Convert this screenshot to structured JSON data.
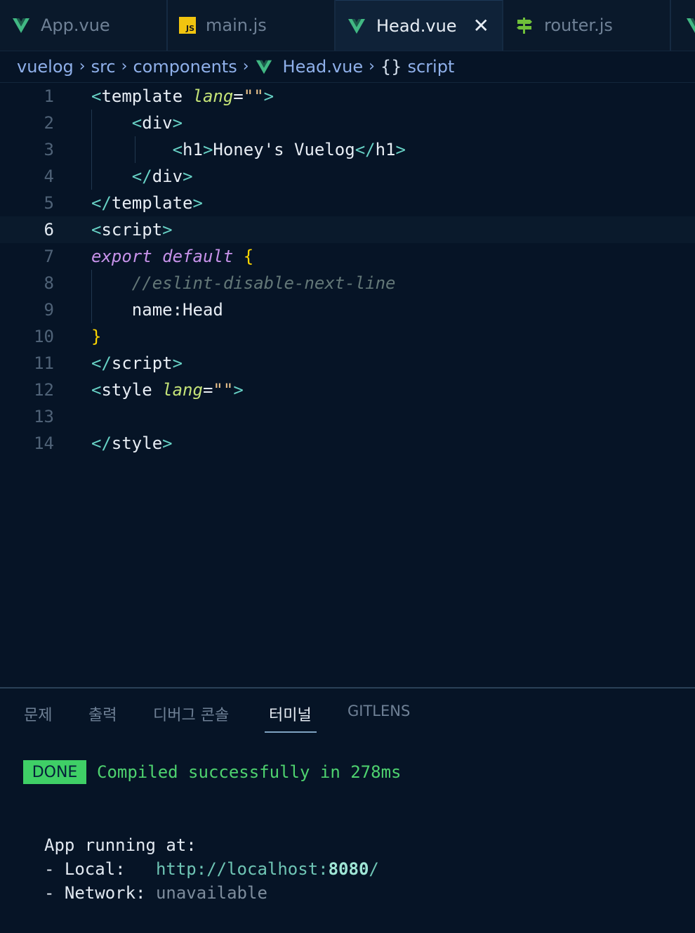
{
  "tabs": [
    {
      "label": "App.vue",
      "icon": "vue-icon",
      "active": false
    },
    {
      "label": "main.js",
      "icon": "js-icon",
      "badge": "JS",
      "active": false
    },
    {
      "label": "Head.vue",
      "icon": "vue-icon",
      "active": true,
      "close": "✕"
    },
    {
      "label": "router.js",
      "icon": "signpost-icon",
      "active": false
    }
  ],
  "breadcrumb": {
    "items": [
      "vuelog",
      "src",
      "components",
      "Head.vue",
      "script"
    ],
    "separator": "›",
    "symbol_braces": "{}"
  },
  "editor": {
    "current_line": 6,
    "line_numbers": [
      "1",
      "2",
      "3",
      "4",
      "5",
      "6",
      "7",
      "8",
      "9",
      "10",
      "11",
      "12",
      "13",
      "14"
    ],
    "lines": [
      [
        {
          "c": "t-tag",
          "t": "<"
        },
        {
          "c": "t-name",
          "t": "template"
        },
        {
          "c": "t-text",
          "t": " "
        },
        {
          "c": "t-attr",
          "t": "lang"
        },
        {
          "c": "t-text",
          "t": "="
        },
        {
          "c": "t-str",
          "t": "\"\""
        },
        {
          "c": "t-tag",
          "t": ">"
        }
      ],
      [
        {
          "c": "t-text",
          "t": "    "
        },
        {
          "c": "t-tag",
          "t": "<"
        },
        {
          "c": "t-name",
          "t": "div"
        },
        {
          "c": "t-tag",
          "t": ">"
        }
      ],
      [
        {
          "c": "t-text",
          "t": "        "
        },
        {
          "c": "t-tag",
          "t": "<"
        },
        {
          "c": "t-name",
          "t": "h1"
        },
        {
          "c": "t-tag",
          "t": ">"
        },
        {
          "c": "t-text",
          "t": "Honey's Vuelog"
        },
        {
          "c": "t-tag",
          "t": "</"
        },
        {
          "c": "t-name",
          "t": "h1"
        },
        {
          "c": "t-tag",
          "t": ">"
        }
      ],
      [
        {
          "c": "t-text",
          "t": "    "
        },
        {
          "c": "t-tag",
          "t": "</"
        },
        {
          "c": "t-name",
          "t": "div"
        },
        {
          "c": "t-tag",
          "t": ">"
        }
      ],
      [
        {
          "c": "t-tag",
          "t": "</"
        },
        {
          "c": "t-name",
          "t": "template"
        },
        {
          "c": "t-tag",
          "t": ">"
        }
      ],
      [
        {
          "c": "t-tag",
          "t": "<"
        },
        {
          "c": "t-name",
          "t": "script"
        },
        {
          "c": "t-tag",
          "t": ">"
        }
      ],
      [
        {
          "c": "t-kw",
          "t": "export"
        },
        {
          "c": "t-text",
          "t": " "
        },
        {
          "c": "t-kw",
          "t": "default"
        },
        {
          "c": "t-text",
          "t": " "
        },
        {
          "c": "t-brace",
          "t": "{"
        }
      ],
      [
        {
          "c": "t-text",
          "t": "    "
        },
        {
          "c": "t-comment",
          "t": "//eslint-disable-next-line"
        }
      ],
      [
        {
          "c": "t-text",
          "t": "    name:Head"
        }
      ],
      [
        {
          "c": "t-brace",
          "t": "}"
        }
      ],
      [
        {
          "c": "t-tag",
          "t": "</"
        },
        {
          "c": "t-name",
          "t": "script"
        },
        {
          "c": "t-tag",
          "t": ">"
        }
      ],
      [
        {
          "c": "t-tag",
          "t": "<"
        },
        {
          "c": "t-name",
          "t": "style"
        },
        {
          "c": "t-text",
          "t": " "
        },
        {
          "c": "t-attr",
          "t": "lang"
        },
        {
          "c": "t-text",
          "t": "="
        },
        {
          "c": "t-str",
          "t": "\"\""
        },
        {
          "c": "t-tag",
          "t": ">"
        }
      ],
      [],
      [
        {
          "c": "t-tag",
          "t": "</"
        },
        {
          "c": "t-name",
          "t": "style"
        },
        {
          "c": "t-tag",
          "t": ">"
        }
      ]
    ]
  },
  "panel": {
    "tabs": [
      "문제",
      "출력",
      "디버그 콘솔",
      "터미널",
      "GITLENS"
    ],
    "active_tab": "터미널"
  },
  "terminal": {
    "badge": "DONE",
    "message": "Compiled successfully in 278ms",
    "running_label": "App running at:",
    "local_label": "- Local:   ",
    "local_url_prefix": "http://localhost:",
    "local_url_port": "8080",
    "local_url_suffix": "/",
    "network_label": "- Network: ",
    "network_value": "unavailable"
  },
  "colors": {
    "background": "#061426",
    "tag": "#67d1c5",
    "keyword": "#c792ea",
    "attribute": "#c5e478",
    "string": "#ecc48d",
    "comment": "#637777",
    "done_green": "#3fcf66"
  }
}
